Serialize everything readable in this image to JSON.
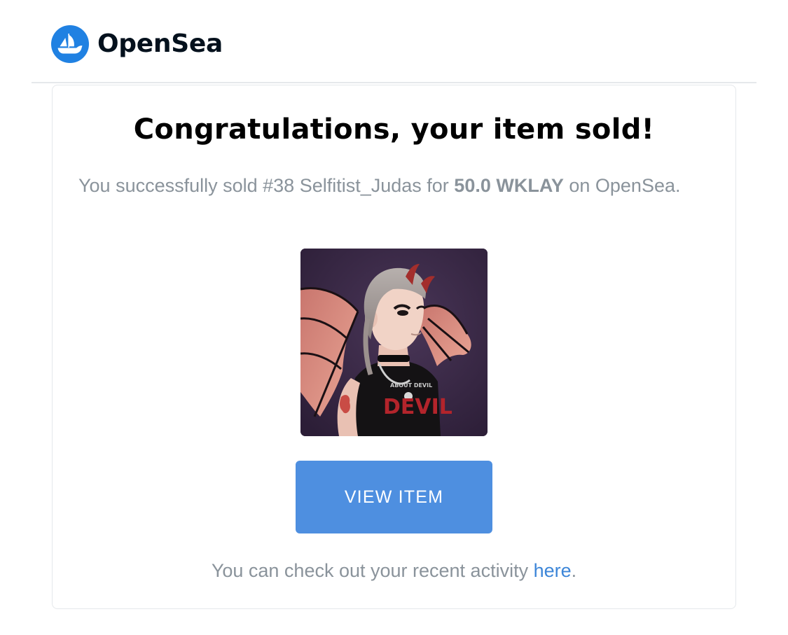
{
  "header": {
    "brand_name": "OpenSea",
    "logo_icon": "opensea-ship-logo-icon",
    "brand_color": "#2081e2"
  },
  "card": {
    "title": "Congratulations, your item sold!",
    "message_prefix": "You successfully sold #38 Selfitist_Judas for ",
    "price": "50.0 WKLAY",
    "message_suffix": " on OpenSea.",
    "item_image": "nft-character-devil-horns-bat-wings",
    "view_button_label": "VIEW ITEM",
    "button_color": "#4e8fe0",
    "activity_prefix": "You can check out your recent activity ",
    "activity_link": "here",
    "activity_suffix": "."
  }
}
